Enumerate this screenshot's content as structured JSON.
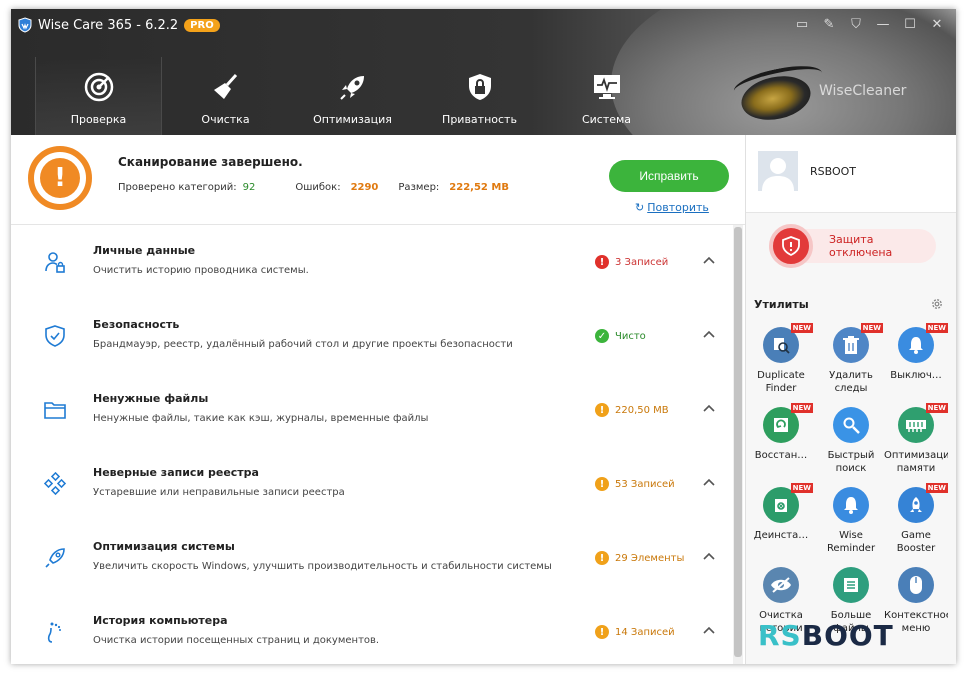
{
  "app": {
    "title": "Wise Care 365 - 6.2.2",
    "badge": "PRO",
    "brand": "WiseCleaner"
  },
  "nav": [
    {
      "label": "Проверка",
      "icon": "radar-icon"
    },
    {
      "label": "Очистка",
      "icon": "broom-icon"
    },
    {
      "label": "Оптимизация",
      "icon": "rocket-icon"
    },
    {
      "label": "Приватность",
      "icon": "shield-lock-icon"
    },
    {
      "label": "Система",
      "icon": "monitor-icon"
    }
  ],
  "summary": {
    "title": "Сканирование завершено.",
    "checked_label": "Проверено категорий:",
    "checked": "92",
    "errors_label": "Ошибок:",
    "errors": "2290",
    "size_label": "Размер:",
    "size": "222,52 MB",
    "fix": "Исправить",
    "repeat": "Повторить"
  },
  "items": [
    {
      "title": "Личные данные",
      "desc": "Очистить историю проводника системы.",
      "status": "3 Записей",
      "level": "error"
    },
    {
      "title": "Безопасность",
      "desc": "Брандмауэр, реестр, удалённый рабочий стол и другие проекты безопасности",
      "status": "Чисто",
      "level": "ok"
    },
    {
      "title": "Ненужные файлы",
      "desc": "Ненужные файлы, такие как кэш, журналы, временные файлы",
      "status": "220,50 MB",
      "level": "warn"
    },
    {
      "title": "Неверные записи реестра",
      "desc": "Устаревшие или неправильные записи реестра",
      "status": "53 Записей",
      "level": "warn"
    },
    {
      "title": "Оптимизация системы",
      "desc": "Увеличить скорость Windows, улучшить производительность и стабильности системы",
      "status": "29 Элементы",
      "level": "warn"
    },
    {
      "title": "История компьютера",
      "desc": "Очистка истории посещенных страниц и документов.",
      "status": "14 Записей",
      "level": "warn"
    }
  ],
  "user": {
    "name": "RSBOOT"
  },
  "protection": {
    "label": "Защита отключена"
  },
  "utilities": {
    "title": "Утилиты",
    "new_label": "NEW",
    "tools": [
      {
        "label": "Duplicate Finder",
        "new": true
      },
      {
        "label": "Удалить следы",
        "new": true
      },
      {
        "label": "Выключ…",
        "new": true
      },
      {
        "label": "Восстан…",
        "new": true
      },
      {
        "label": "Быстрый поиск",
        "new": false
      },
      {
        "label": "Оптимизация памяти",
        "new": true
      },
      {
        "label": "Деинста…",
        "new": true
      },
      {
        "label": "Wise Reminder",
        "new": false
      },
      {
        "label": "Game Booster",
        "new": true
      },
      {
        "label": "Очистка истории",
        "new": false
      },
      {
        "label": "Больше файлы",
        "new": false
      },
      {
        "label": "Контекстное меню",
        "new": false
      }
    ]
  },
  "watermark": {
    "left": "RS",
    "right": "BOOT"
  },
  "colors": {
    "accent_green": "#3cb43c",
    "warn": "#f0a11a",
    "error": "#e0312b",
    "ok": "#3cb43c",
    "link": "#1a6fc0"
  }
}
